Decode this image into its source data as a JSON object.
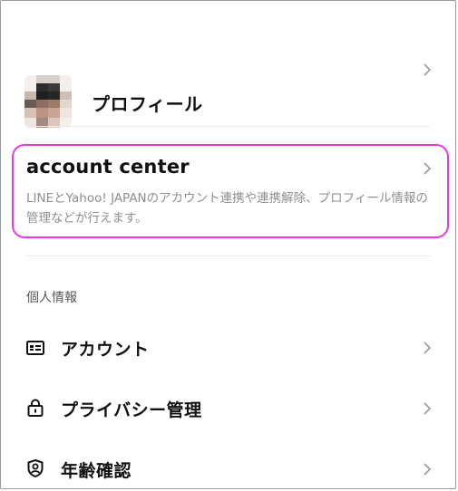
{
  "profile": {
    "label": "プロフィール"
  },
  "account_center": {
    "title": "account center",
    "description": "LINEとYahoo! JAPANのアカウント連携や連携解除、プロフィール情報の管理などが行えます。"
  },
  "personal_info": {
    "section_label": "個人情報",
    "items": [
      {
        "label": "アカウント",
        "icon": "id-card-icon"
      },
      {
        "label": "プライバシー管理",
        "icon": "lock-icon"
      },
      {
        "label": "年齢確認",
        "icon": "shield-person-icon"
      }
    ]
  },
  "colors": {
    "highlight": "#e23be0",
    "chevron": "#999999",
    "description": "#8f8f8f"
  }
}
